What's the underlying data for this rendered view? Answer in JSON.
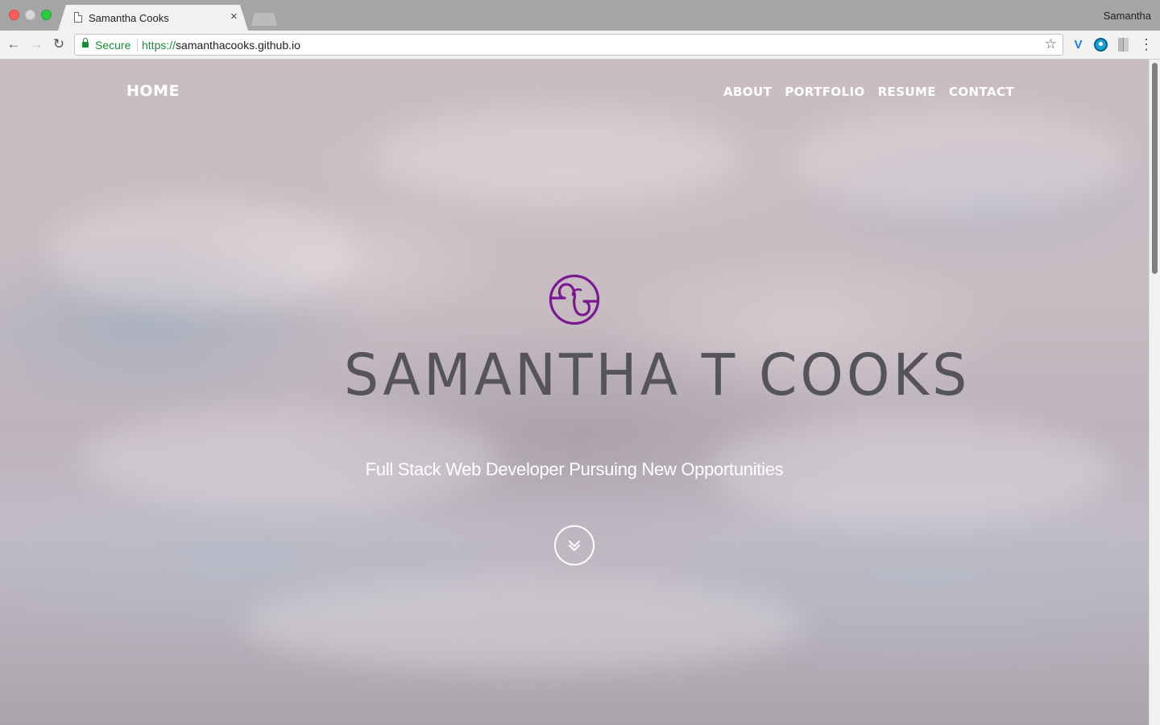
{
  "browser": {
    "tab_title": "Samantha Cooks",
    "tab_close": "×",
    "profile_name": "Samantha",
    "security_label": "Secure",
    "url_scheme": "https://",
    "url_host": "samanthacooks.github.io",
    "back_glyph": "←",
    "forward_glyph": "→",
    "reload_glyph": "↻",
    "star_glyph": "☆",
    "menu_glyph": "⋮",
    "extension_glyph": "V"
  },
  "site": {
    "nav": {
      "home": "HOME",
      "links": [
        "ABOUT",
        "PORTFOLIO",
        "RESUME",
        "CONTACT"
      ]
    },
    "logo_wordmark": "SAMANTHA T COOKS",
    "logo_color": "#7a1a8f",
    "tagline": "Full Stack Web Developer Pursuing New Opportunities",
    "scroll_icon": "double-chevron-down-icon"
  }
}
